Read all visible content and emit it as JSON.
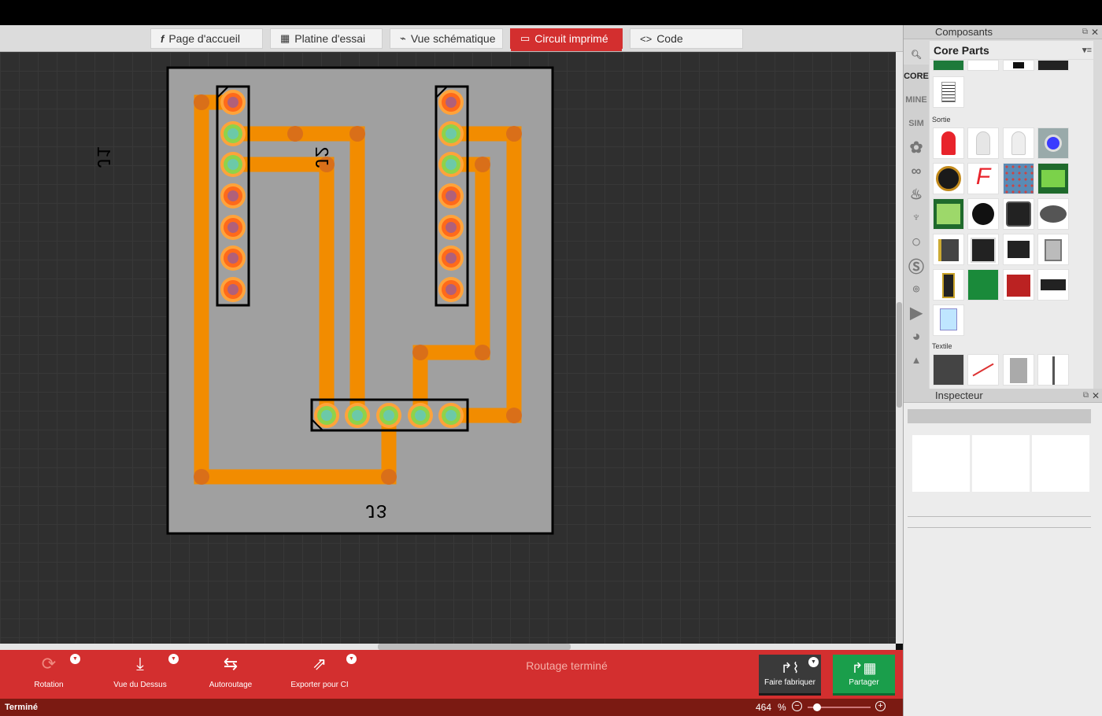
{
  "tabs": [
    {
      "icon": "f",
      "label": "Page d'accueil"
    },
    {
      "icon": "▦",
      "label": "Platine d'essai"
    },
    {
      "icon": "⌁",
      "label": "Vue schématique"
    },
    {
      "icon": "▭",
      "label": "Circuit imprimé"
    },
    {
      "icon": "<>",
      "label": "Code"
    }
  ],
  "active_tab": "Circuit imprimé",
  "pcb": {
    "labels": {
      "j1": "J1",
      "j2": "J2",
      "j3": "J3"
    },
    "colors": {
      "board": "#a0a0a0",
      "trace": "#f28c00",
      "pad": "#ff6a00",
      "pad_green": "#6ec946",
      "via": "#d96f19",
      "outline": "#000000"
    }
  },
  "toolbar": {
    "rotation": "Rotation",
    "top_view": "Vue du Dessus",
    "autoroute": "Autoroutage",
    "export": "Exporter pour CI",
    "status_message": "Routage terminé",
    "fabricate": "Faire fabriquer",
    "share": "Partager"
  },
  "statusbar": {
    "left": "Terminé",
    "zoom": "464",
    "zoom_unit": "%",
    "zoom_level_fraction": 0.15
  },
  "components_panel": {
    "title": "Composants",
    "bin_title": "Core Parts",
    "bins": [
      "CORE",
      "MINE",
      "SIM"
    ],
    "sections": [
      "Sortie",
      "Textile"
    ]
  },
  "inspector": {
    "title": "Inspecteur"
  }
}
